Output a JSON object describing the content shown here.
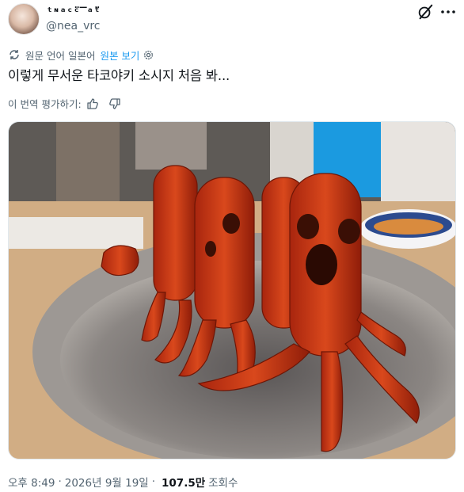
{
  "author": {
    "display_name": "ᵗᶰᵃᶜ̈ᶜ‾ᵃ̈ᵗ",
    "handle": "@nea_vrc"
  },
  "translation": {
    "label": "원문 언어 일본어",
    "view_original": "원본 보기"
  },
  "tweet": {
    "text": "이렇게 무서운 타코야키 소시지 처음 봐..."
  },
  "rating": {
    "label": "이 번역 평가하기:"
  },
  "meta": {
    "time": "오후 8:49",
    "date": "2026년 9월 19일",
    "views_count": "107.5만",
    "views_label": "조회수"
  },
  "icons": {
    "grok": "grok-slash-icon",
    "more": "more-dots-icon",
    "translate": "translate-icon",
    "settings": "gear-icon",
    "thumbs_up": "thumbs-up-icon",
    "thumbs_down": "thumbs-down-icon"
  },
  "colors": {
    "link": "#1d9bf0",
    "secondary_text": "#536471",
    "primary_text": "#0f1419"
  }
}
